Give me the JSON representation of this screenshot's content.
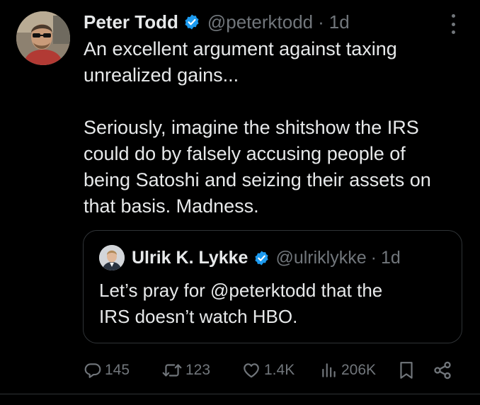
{
  "tweet": {
    "author": {
      "name": "Peter Todd",
      "handle": "@peterktodd",
      "verified": true,
      "avatar_icon": "profile-photo"
    },
    "separator": "·",
    "time": "1d",
    "text": "An excellent argument against taxing\nunrealized gains...\n\nSeriously, imagine the shitshow the IRS\ncould do by falsely accusing people of\nbeing Satoshi and seizing their assets on\nthat basis. Madness.",
    "more_icon": "more-vertical-icon"
  },
  "quote": {
    "author": {
      "name": "Ulrik K. Lykke",
      "handle": "@ulriklykke",
      "verified": true,
      "avatar_icon": "profile-photo"
    },
    "separator": "·",
    "time": "1d",
    "text": "Let’s pray for @peterktodd that the\nIRS doesn’t watch HBO."
  },
  "actions": {
    "reply": {
      "icon": "reply-icon",
      "count": "145"
    },
    "repost": {
      "icon": "repost-icon",
      "count": "123"
    },
    "like": {
      "icon": "like-icon",
      "count": "1.4K"
    },
    "views": {
      "icon": "views-icon",
      "count": "206K"
    },
    "bookmark": {
      "icon": "bookmark-icon"
    },
    "share": {
      "icon": "share-icon"
    }
  },
  "colors": {
    "background": "#000000",
    "text_primary": "#e7e9ea",
    "text_secondary": "#71767b",
    "verified_badge": "#1d9bf0",
    "border": "#2f3336"
  }
}
